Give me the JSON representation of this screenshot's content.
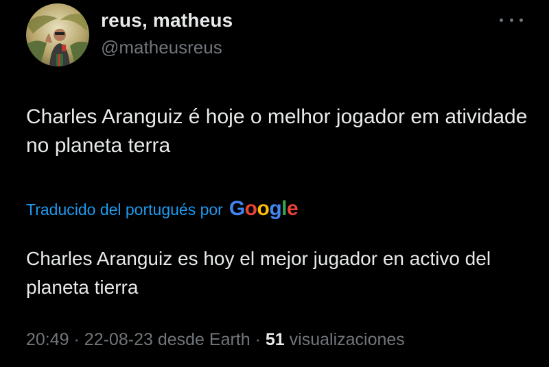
{
  "author": {
    "display_name": "reus, matheus",
    "handle": "@matheusreus"
  },
  "tweet": {
    "text": "Charles Aranguiz é hoje o melhor jogador em atividade no planeta terra"
  },
  "translation": {
    "label": "Traducido del portugués por",
    "provider_letters": [
      "G",
      "o",
      "o",
      "g",
      "l",
      "e"
    ],
    "provider_colors": [
      "#4285f4",
      "#ea4335",
      "#fbbc05",
      "#4285f4",
      "#34a853",
      "#ea4335"
    ],
    "text": "Charles Aranguiz es hoy el mejor jugador en activo del planeta tierra"
  },
  "meta": {
    "time": "20:49",
    "separator_1": "·",
    "date": "22-08-23",
    "source": "desde Earth",
    "separator_2": "·",
    "views_count": "51",
    "views_label": "visualizaciones"
  },
  "icons": {
    "more": "more-horizontal-icon",
    "avatar": "profile-photo"
  },
  "colors": {
    "background": "#000000",
    "primary_text": "#e7e9ea",
    "secondary_text": "#71767b",
    "link": "#1d9bf0"
  }
}
